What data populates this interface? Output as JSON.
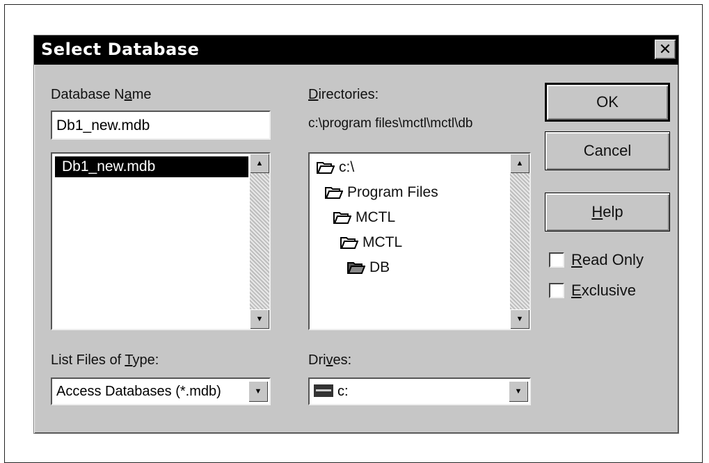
{
  "dialog": {
    "title": "Select Database",
    "close_label": "✕"
  },
  "database_name": {
    "label_pre": "Database N",
    "label_accel": "a",
    "label_post": "me",
    "value": "Db1_new.mdb",
    "files": [
      "Db1_new.mdb"
    ],
    "selected_index": 0
  },
  "directories": {
    "label_accel": "D",
    "label_post": "irectories:",
    "current_path": "c:\\program files\\mctl\\mctl\\db",
    "items": [
      {
        "label": "c:\\",
        "icon": "open-folder-icon"
      },
      {
        "label": "Program Files",
        "icon": "open-folder-icon"
      },
      {
        "label": "MCTL",
        "icon": "open-folder-icon"
      },
      {
        "label": "MCTL",
        "icon": "open-folder-icon"
      },
      {
        "label": "DB",
        "icon": "open-folder-icon"
      }
    ]
  },
  "file_type": {
    "label_pre": "List Files of ",
    "label_accel": "T",
    "label_post": "ype:",
    "selected": "Access Databases (*.mdb)"
  },
  "drives": {
    "label_pre": "Dri",
    "label_accel": "v",
    "label_post": "es:",
    "selected": "c:",
    "icon": "hard-drive-icon"
  },
  "buttons": {
    "ok": "OK",
    "cancel": "Cancel",
    "help_accel": "H",
    "help_post": "elp"
  },
  "options": {
    "read_only_accel": "R",
    "read_only_post": "ead Only",
    "read_only_checked": false,
    "exclusive_accel": "E",
    "exclusive_post": "xclusive",
    "exclusive_checked": false
  }
}
